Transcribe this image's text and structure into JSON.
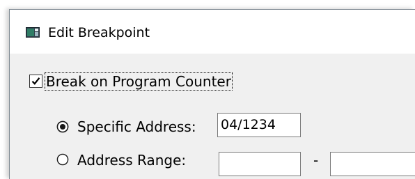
{
  "window": {
    "title": "Edit Breakpoint",
    "icon": "app-window-icon"
  },
  "break_on_pc": {
    "label": "Break on Program Counter",
    "checked": true
  },
  "specific_address": {
    "label": "Specific Address:",
    "selected": true,
    "value": "04/1234"
  },
  "address_range": {
    "label": "Address Range:",
    "selected": false,
    "start_value": "",
    "end_value": "",
    "separator": "-"
  }
}
